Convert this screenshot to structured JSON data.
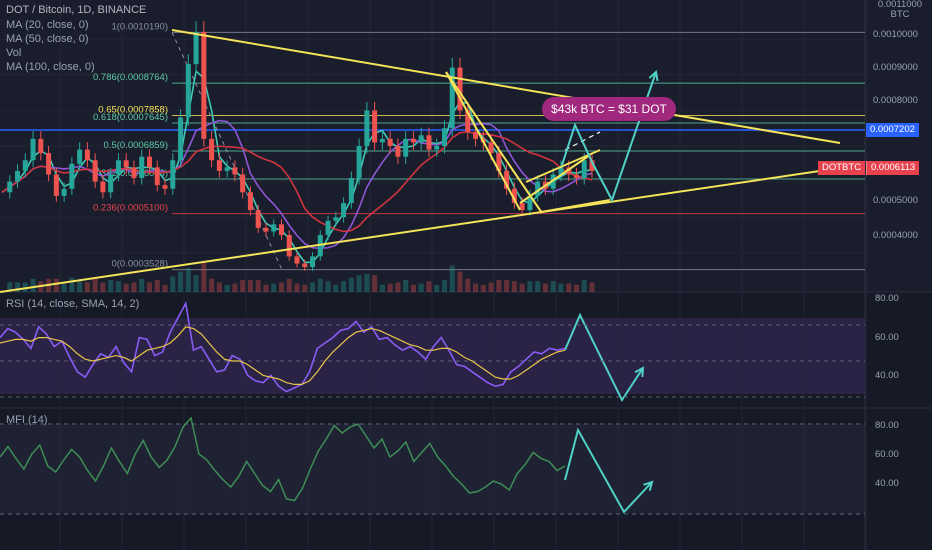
{
  "header": {
    "title": "DOT / Bitcoin, 1D, BINANCE",
    "indicators": [
      "MA (20, close, 0)",
      "MA (50, close, 0)",
      "Vol",
      "MA (100, close, 0)"
    ]
  },
  "price_axis": {
    "currency": "BTC",
    "top_label": "0.0011000",
    "ticks": [
      "0.0010000",
      "0.0009000",
      "0.0008000",
      "0.0006000",
      "0.0005000",
      "0.0004000"
    ]
  },
  "price_tags": {
    "level": "0.0007202",
    "symbol": "DOTBTC",
    "last": "0.0006113"
  },
  "callout": "$43k BTC = $31 DOT",
  "rsi": {
    "title": "RSI (14, close, SMA, 14, 2)",
    "ticks": [
      "80.00",
      "60.00",
      "40.00"
    ]
  },
  "mfi": {
    "title": "MFI (14)",
    "ticks": [
      "80.00",
      "60.00",
      "40.00"
    ]
  },
  "colors": {
    "background": "#1a1e2c",
    "candle_up": "#26a69a",
    "candle_down": "#ef5350",
    "trendline": "#f5e35a",
    "projection": "#4fd1c5",
    "ma20": "#3ec9b4",
    "ma50": "#8e55d6",
    "ma100": "#d1343f",
    "rsi_line": "#8a5cf6",
    "rsi_ma": "#e8c547",
    "mfi_line": "#3e8e55",
    "level_blue": "#2962ff",
    "callout": "#a0287e"
  },
  "chart_data": {
    "type": "candlestick",
    "title": "DOT / Bitcoin, 1D, BINANCE",
    "y_unit": "BTC",
    "ylim": [
      0.00029,
      0.00111
    ],
    "fib_levels": [
      {
        "label": "1(0.0010190)",
        "value": 0.001019
      },
      {
        "label": "0.786(0.0008764)",
        "value": 0.0008764
      },
      {
        "label": "0.65(0.0007858)",
        "value": 0.0007858
      },
      {
        "label": "0.618(0.0007645)",
        "value": 0.0007645
      },
      {
        "label": "0.5(0.0006859)",
        "value": 0.0006859
      },
      {
        "label": "0.382(0.0006073)",
        "value": 0.0006073
      },
      {
        "label": "0.236(0.0005100)",
        "value": 0.00051
      },
      {
        "label": "0(0.0003528)",
        "value": 0.0003528
      }
    ],
    "price_path": [
      0.00057,
      0.0006,
      0.00063,
      0.00066,
      0.00072,
      0.00068,
      0.00062,
      0.00056,
      0.00058,
      0.00065,
      0.00069,
      0.00066,
      0.0006,
      0.00057,
      0.00062,
      0.00066,
      0.00064,
      0.00061,
      0.00067,
      0.00064,
      0.00059,
      0.00058,
      0.00066,
      0.00078,
      0.00093,
      0.00102,
      0.00072,
      0.00066,
      0.00063,
      0.00064,
      0.00062,
      0.00057,
      0.00052,
      0.00047,
      0.00046,
      0.00048,
      0.00045,
      0.00039,
      0.00037,
      0.00036,
      0.00039,
      0.00045,
      0.00049,
      0.0005,
      0.00054,
      0.00061,
      0.0007,
      0.0008,
      0.00071,
      0.00072,
      0.0007,
      0.00067,
      0.00072,
      0.00071,
      0.00073,
      0.00069,
      0.0007,
      0.00075,
      0.00092,
      0.0008,
      0.00074,
      0.00072,
      0.00071,
      0.00068,
      0.00063,
      0.00058,
      0.00054,
      0.00052,
      0.00056,
      0.0006,
      0.00058,
      0.00062,
      0.00064,
      0.00062,
      0.00061,
      0.00066,
      0.00063
    ],
    "rsi_path": [
      63,
      68,
      66,
      62,
      57,
      69,
      65,
      58,
      61,
      52,
      44,
      41,
      48,
      54,
      52,
      58,
      49,
      44,
      63,
      62,
      53,
      55,
      66,
      74,
      82,
      56,
      58,
      51,
      44,
      45,
      53,
      51,
      42,
      39,
      38,
      42,
      36,
      33,
      35,
      37,
      44,
      57,
      60,
      63,
      67,
      68,
      72,
      66,
      69,
      62,
      63,
      59,
      56,
      58,
      55,
      51,
      58,
      63,
      56,
      48,
      47,
      44,
      41,
      38,
      36,
      37,
      44,
      47,
      51,
      55,
      54,
      57,
      56,
      57
    ],
    "rsi_ma_path": [
      60,
      61,
      62,
      62,
      61,
      63,
      63,
      62,
      61,
      58,
      54,
      51,
      50,
      51,
      52,
      53,
      52,
      50,
      53,
      56,
      57,
      58,
      60,
      64,
      69,
      68,
      65,
      60,
      55,
      51,
      50,
      50,
      48,
      45,
      42,
      41,
      40,
      38,
      37,
      37,
      39,
      44,
      50,
      55,
      59,
      63,
      66,
      67,
      68,
      67,
      65,
      63,
      61,
      59,
      58,
      56,
      56,
      57,
      57,
      55,
      52,
      50,
      47,
      44,
      41,
      40,
      40,
      42,
      45,
      48,
      51,
      53,
      55,
      56
    ],
    "mfi_path": [
      58,
      65,
      57,
      50,
      60,
      66,
      52,
      48,
      56,
      63,
      58,
      49,
      42,
      52,
      64,
      55,
      47,
      60,
      69,
      58,
      51,
      56,
      65,
      78,
      84,
      60,
      56,
      49,
      43,
      38,
      45,
      55,
      47,
      39,
      35,
      43,
      30,
      29,
      37,
      50,
      62,
      70,
      79,
      74,
      78,
      80,
      72,
      64,
      70,
      58,
      62,
      68,
      55,
      61,
      67,
      58,
      52,
      45,
      40,
      34,
      35,
      38,
      42,
      40,
      36,
      47,
      53,
      61,
      57,
      55,
      49,
      52
    ],
    "projection_note": "Projected path drawn as arrows on price, RSI and MFI panes"
  }
}
